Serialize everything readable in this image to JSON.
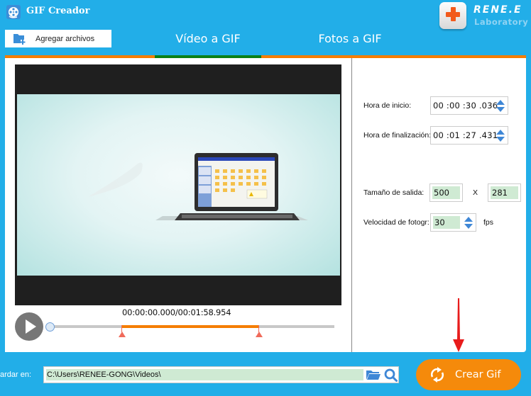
{
  "app": {
    "title": "GIF Creador",
    "logo_name": "RENE.E",
    "logo_sub": "Laboratory"
  },
  "toolbar": {
    "add_files_label": "Agregar archivos"
  },
  "tabs": [
    {
      "label": "Vídeo a GIF",
      "active": true
    },
    {
      "label": "Fotos a GIF",
      "active": false
    }
  ],
  "player": {
    "current_time": "00:00:00.000",
    "separator": "/",
    "total_time": "00:01:58.954",
    "playhead_fraction": 0.0,
    "selection_start_fraction": 0.252,
    "selection_end_fraction": 0.733
  },
  "settings": {
    "start_time_label": "Hora de inicio:",
    "start_time_value": "00 :00 :30 .036",
    "end_time_label": "Hora de finalización:",
    "end_time_value": "00 :01 :27 .431",
    "output_size_label": "Tamaño de salida:",
    "width_value": "500",
    "size_separator": "X",
    "height_value": "281",
    "frame_rate_label": "Velocidad de fotogr:",
    "frame_rate_value": "30",
    "frame_rate_unit": "fps"
  },
  "footer": {
    "save_label": "ardar en:",
    "save_path": "C:\\Users\\RENEE-GONG\\Videos\\",
    "create_label": "Crear Gif"
  },
  "colors": {
    "primary": "#22aee8",
    "accent_orange": "#f57d00",
    "active_tab_green": "#0a8015",
    "button_orange": "#f58a0b",
    "annotation_red": "#e81c1c"
  }
}
